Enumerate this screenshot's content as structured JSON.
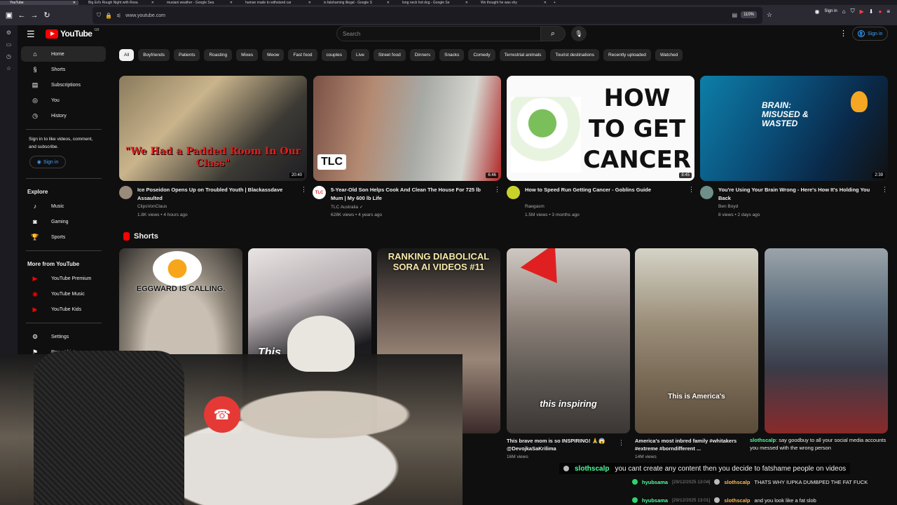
{
  "browser": {
    "tabs": [
      "YouTube",
      "Big Ed's Rough Night with Rosa",
      "musiani weather - Google Sea",
      "human made to withstand car",
      "is fatshaming illegal - Google S",
      "long neck hot dog - Google Se",
      "We thought he was shy"
    ],
    "url": "www.youtube.com",
    "zoom": "110%",
    "signin_label": "Sign in"
  },
  "youtube": {
    "logo_text": "YouTube",
    "country_code": "GB",
    "search_placeholder": "Search",
    "signin_label": "Sign in"
  },
  "sidebar": {
    "main": [
      {
        "label": "Home",
        "icon": "home-icon"
      },
      {
        "label": "Shorts",
        "icon": "shorts-icon"
      },
      {
        "label": "Subscriptions",
        "icon": "subscriptions-icon"
      },
      {
        "label": "You",
        "icon": "you-icon"
      },
      {
        "label": "History",
        "icon": "history-icon"
      }
    ],
    "signin_note": "Sign in to like videos, comment, and subscribe.",
    "signin_button": "Sign in",
    "explore_heading": "Explore",
    "explore": [
      {
        "label": "Music",
        "icon": "music-icon"
      },
      {
        "label": "Gaming",
        "icon": "gaming-icon"
      },
      {
        "label": "Sports",
        "icon": "sports-icon"
      }
    ],
    "more_heading": "More from YouTube",
    "more": [
      {
        "label": "YouTube Premium",
        "icon": "youtube-premium-icon"
      },
      {
        "label": "YouTube Music",
        "icon": "youtube-music-icon"
      },
      {
        "label": "YouTube Kids",
        "icon": "youtube-kids-icon"
      }
    ],
    "settings": [
      {
        "label": "Settings",
        "icon": "settings-icon"
      },
      {
        "label": "Report history",
        "icon": "report-history-icon"
      }
    ]
  },
  "chips": [
    "All",
    "Boyfriends",
    "Patients",
    "Roasting",
    "Mixes",
    "Meow",
    "Fast food",
    "couples",
    "Live",
    "Street food",
    "Dinners",
    "Snacks",
    "Comedy",
    "Terrestrial animals",
    "Tourist destinations",
    "Recently uploaded",
    "Watched"
  ],
  "videos": [
    {
      "title": "Ice Poseidon Opens Up on Troubled Youth | Blackassdave Assaulted",
      "channel": "ClipsVonClaus",
      "meta": "1.8K views • 4 hours ago",
      "duration": "20:40",
      "thumb_text": "\"We Had a Padded Room In Our Class\""
    },
    {
      "title": "5-Year-Old Son Helps Cook And Clean The House For 725 lb Mum | My 600 lb Life",
      "channel": "TLC Australia",
      "meta": "628K views • 4 years ago",
      "duration": "6:46",
      "thumb_text": "TLC"
    },
    {
      "title": "How to Speed Run Getting Cancer - Goblins Guide",
      "channel": "Raegasm",
      "meta": "1.5M views • 3 months ago",
      "duration": "8:45",
      "thumb_text": "HOW TO GET CANCER"
    },
    {
      "title": "You're Using Your Brain Wrong - Here's How It's Holding You Back",
      "channel": "Ben Boyd",
      "meta": "8 views • 2 days ago",
      "duration": "2:39",
      "thumb_text": "BRAIN: MISUSED & WASTED"
    }
  ],
  "shorts_heading": "Shorts",
  "shorts": [
    {
      "caption": "EGGWARD IS CALLING.",
      "title": "",
      "views": ""
    },
    {
      "caption": "This",
      "title": "",
      "views": ""
    },
    {
      "caption": "RANKING DIABOLICAL SORA AI VIDEOS #11",
      "title": "",
      "views": ""
    },
    {
      "caption": "this inspiring",
      "title": "This brave mom is so INSPIRING! 🙏😱 @DevojkaSaKrilima",
      "views": "16M views"
    },
    {
      "caption": "This is America's",
      "title": "America's most inbred family #whitakers #extreme #borndifferent ...",
      "views": "14M views"
    },
    {
      "caption": "",
      "title": "",
      "views": ""
    }
  ],
  "overlay": {
    "main_chat": {
      "user": "slothscalp",
      "message": "you cant create any content then you decide to fatshame people on videos"
    },
    "bubble": {
      "user": "slothscalp",
      "message": "say goodbuy to all your social media accounts you messed with the wrong person"
    },
    "lines": [
      {
        "user": "hyubsama",
        "ts": "[29/12/2025 13:04]",
        "user2": "slothscalp",
        "message": "THATS WHY IUPKA DUMBPED THE FAT FUCK"
      },
      {
        "user": "hyubsama",
        "ts": "[29/12/2025 13:01]",
        "user2": "slothscalp",
        "message": "and you look like a fat slob"
      }
    ]
  }
}
